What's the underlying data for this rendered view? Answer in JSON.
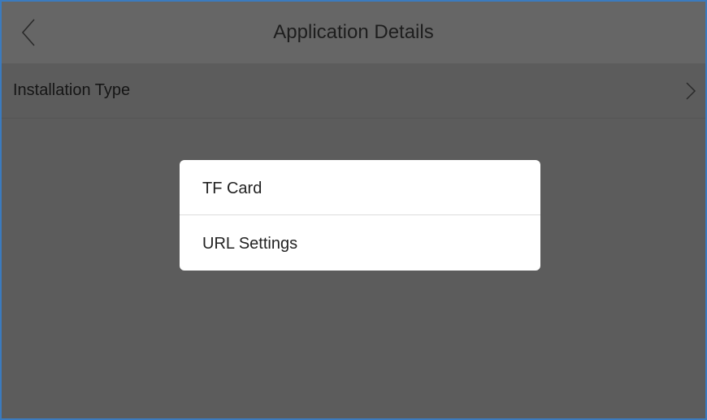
{
  "header": {
    "title": "Application Details",
    "back_icon": "chevron-left-icon"
  },
  "settings": {
    "installation_type_label": "Installation Type",
    "chevron_icon": "chevron-right-icon"
  },
  "dialog": {
    "options": [
      {
        "label": "TF Card"
      },
      {
        "label": "URL Settings"
      }
    ]
  },
  "colors": {
    "frame_border": "#3b7bbf",
    "overlay_background": "#5c5c5c",
    "header_background": "#666666",
    "dialog_background": "#ffffff"
  }
}
